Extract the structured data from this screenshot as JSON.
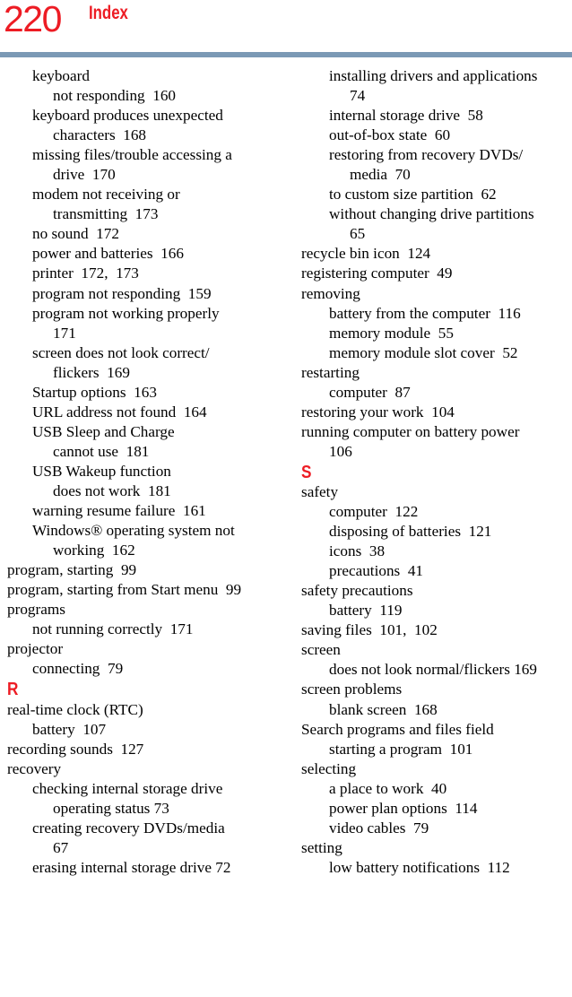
{
  "header": {
    "page_number": "220",
    "title": "Index",
    "rule_color": "#7B99B5",
    "accent_color": "#ED1C24"
  },
  "columns": [
    {
      "name": "left",
      "entries": [
        {
          "level": 1,
          "text": "keyboard"
        },
        {
          "level": 2,
          "text": "not responding  160"
        },
        {
          "level": 1,
          "text": "keyboard produces unexpected"
        },
        {
          "level": 2,
          "text": "characters  168"
        },
        {
          "level": 1,
          "text": "missing files/trouble accessing a"
        },
        {
          "level": 2,
          "text": "drive  170"
        },
        {
          "level": 1,
          "text": "modem not receiving or"
        },
        {
          "level": 2,
          "text": "transmitting  173"
        },
        {
          "level": 1,
          "text": "no sound  172"
        },
        {
          "level": 1,
          "text": "power and batteries  166"
        },
        {
          "level": 1,
          "text": "printer  172,  173"
        },
        {
          "level": 1,
          "text": "program not responding  159"
        },
        {
          "level": 1,
          "text": "program not working properly"
        },
        {
          "level": 2,
          "text": "171"
        },
        {
          "level": 1,
          "text": "screen does not look correct/"
        },
        {
          "level": 2,
          "text": "flickers  169"
        },
        {
          "level": 1,
          "text": "Startup options  163"
        },
        {
          "level": 1,
          "text": "URL address not found  164"
        },
        {
          "level": 1,
          "text": "USB Sleep and Charge"
        },
        {
          "level": 2,
          "text": "cannot use  181"
        },
        {
          "level": 1,
          "text": "USB Wakeup function"
        },
        {
          "level": 2,
          "text": "does not work  181"
        },
        {
          "level": 1,
          "text": "warning resume failure  161"
        },
        {
          "level": 1,
          "text": "Windows® operating system not"
        },
        {
          "level": 2,
          "text": "working  162"
        },
        {
          "level": 0,
          "text": "program, starting  99"
        },
        {
          "level": 0,
          "text": "program, starting from Start menu  99"
        },
        {
          "level": 0,
          "text": "programs"
        },
        {
          "level": 1,
          "text": "not running correctly  171"
        },
        {
          "level": 0,
          "text": "projector"
        },
        {
          "level": 1,
          "text": "connecting  79"
        },
        {
          "level": 0,
          "section": true,
          "text": "R"
        },
        {
          "level": 0,
          "text": "real-time clock (RTC)"
        },
        {
          "level": 1,
          "text": "battery  107"
        },
        {
          "level": 0,
          "text": "recording sounds  127"
        },
        {
          "level": 0,
          "text": "recovery"
        },
        {
          "level": 1,
          "text": "checking internal storage drive"
        },
        {
          "level": 2,
          "text": "operating status 73"
        },
        {
          "level": 1,
          "text": "creating recovery DVDs/media"
        },
        {
          "level": 2,
          "text": "67"
        },
        {
          "level": 1,
          "text": "erasing internal storage drive 72"
        }
      ]
    },
    {
      "name": "right",
      "entries": [
        {
          "level": 1,
          "text": "installing drivers and applications"
        },
        {
          "level": 2,
          "text": "74"
        },
        {
          "level": 1,
          "text": "internal storage drive  58"
        },
        {
          "level": 1,
          "text": "out-of-box state  60"
        },
        {
          "level": 1,
          "text": "restoring from recovery DVDs/"
        },
        {
          "level": 2,
          "text": "media  70"
        },
        {
          "level": 1,
          "text": "to custom size partition  62"
        },
        {
          "level": 1,
          "text": "without changing drive partitions"
        },
        {
          "level": 2,
          "text": "65"
        },
        {
          "level": 0,
          "text": "recycle bin icon  124"
        },
        {
          "level": 0,
          "text": "registering computer  49"
        },
        {
          "level": 0,
          "text": "removing"
        },
        {
          "level": 1,
          "text": "battery from the computer  116"
        },
        {
          "level": 1,
          "text": "memory module  55"
        },
        {
          "level": 1,
          "text": "memory module slot cover  52"
        },
        {
          "level": 0,
          "text": "restarting"
        },
        {
          "level": 1,
          "text": "computer  87"
        },
        {
          "level": 0,
          "text": "restoring your work  104"
        },
        {
          "level": 0,
          "text": "running computer on battery power"
        },
        {
          "level": 1,
          "text": "106"
        },
        {
          "level": 0,
          "section": true,
          "text": "S"
        },
        {
          "level": 0,
          "text": "safety"
        },
        {
          "level": 1,
          "text": "computer  122"
        },
        {
          "level": 1,
          "text": "disposing of batteries  121"
        },
        {
          "level": 1,
          "text": "icons  38"
        },
        {
          "level": 1,
          "text": "precautions  41"
        },
        {
          "level": 0,
          "text": "safety precautions"
        },
        {
          "level": 1,
          "text": "battery  119"
        },
        {
          "level": 0,
          "text": "saving files  101,  102"
        },
        {
          "level": 0,
          "text": "screen"
        },
        {
          "level": 1,
          "text": "does not look normal/flickers 169"
        },
        {
          "level": 0,
          "text": "screen problems"
        },
        {
          "level": 1,
          "text": "blank screen  168"
        },
        {
          "level": 0,
          "text": "Search programs and files field"
        },
        {
          "level": 1,
          "text": "starting a program  101"
        },
        {
          "level": 0,
          "text": "selecting"
        },
        {
          "level": 1,
          "text": "a place to work  40"
        },
        {
          "level": 1,
          "text": "power plan options  114"
        },
        {
          "level": 1,
          "text": "video cables  79"
        },
        {
          "level": 0,
          "text": "setting"
        },
        {
          "level": 1,
          "text": "low battery notifications  112"
        }
      ]
    }
  ]
}
